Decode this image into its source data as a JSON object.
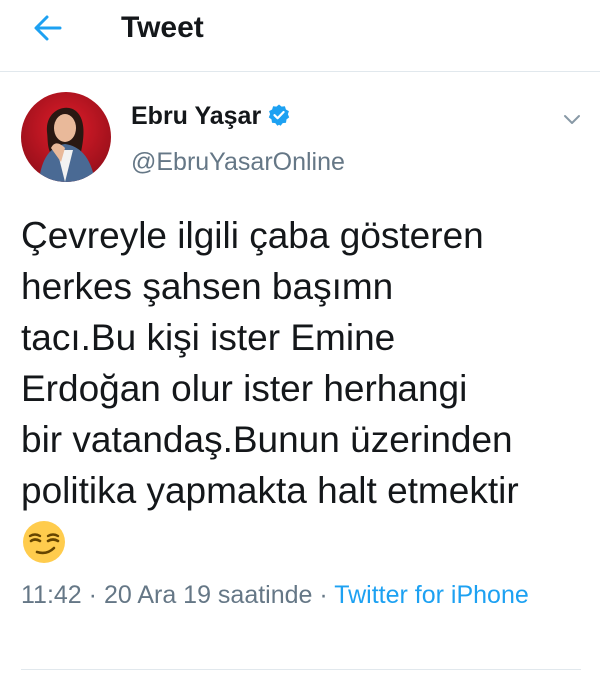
{
  "header": {
    "back_icon": "arrow-left-icon",
    "title": "Tweet"
  },
  "tweet": {
    "author": {
      "name": "Ebru Yaşar",
      "handle": "@EbruYasarOnline",
      "verified_icon": "verified-badge-icon"
    },
    "more_icon": "chevron-down-icon",
    "text_lines": [
      "Çevreyle ilgili çaba gösteren",
      "herkes şahsen başımn",
      "tacı.Bu kişi ister Emine",
      "Erdoğan olur ister herhangi",
      "bir vatandaş.Bunun üzerinden",
      "politika yapmakta halt etmektir"
    ],
    "emoji": "smirking-face-emoji",
    "meta": {
      "time": "11:42",
      "separator": "·",
      "date_text": "20 Ara 19 saatinde",
      "source": "Twitter for iPhone"
    }
  },
  "colors": {
    "accent": "#1da1f2",
    "text": "#14171a",
    "secondary": "#657786",
    "border": "#e1e8ed"
  }
}
